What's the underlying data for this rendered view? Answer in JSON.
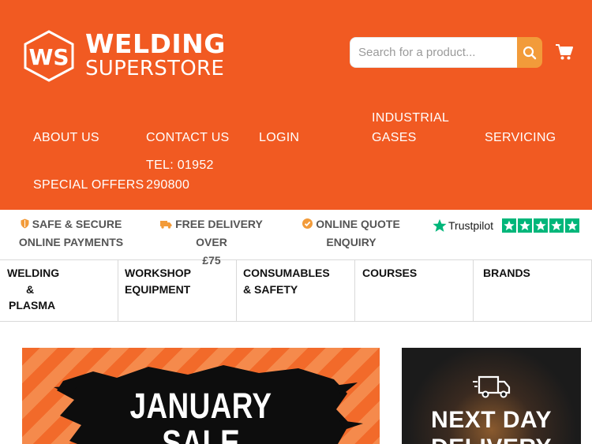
{
  "logo": {
    "line1": "WELDING",
    "line2": "SUPERSTORE",
    "mark_text": "WS"
  },
  "search": {
    "placeholder": "Search for a product...",
    "icon": "search-icon"
  },
  "cart": {
    "icon": "shopping-cart-icon"
  },
  "nav": {
    "about": "ABOUT US",
    "contact": "CONTACT US",
    "login": "LOGIN",
    "industrial_gases_1": "INDUSTRIAL",
    "industrial_gases_2": "GASES",
    "servicing": "SERVICING",
    "special_offers": "SPECIAL OFFERS",
    "tel_1": "TEL: 01952",
    "tel_2": "290800"
  },
  "usps": {
    "secure_1": "SAFE & SECURE",
    "secure_2": "ONLINE PAYMENTS",
    "delivery_1": "FREE DELIVERY OVER",
    "delivery_2": "£75",
    "quote_1": "ONLINE QUOTE",
    "quote_2": "ENQUIRY"
  },
  "trustpilot": {
    "name": "Trustpilot",
    "stars": 5
  },
  "categories": {
    "welding_1": "WELDING",
    "welding_2": "&",
    "welding_3": "PLASMA",
    "workshop_1": "WORKSHOP",
    "workshop_2": "EQUIPMENT",
    "consumables_1": "CONSUMABLES",
    "consumables_2": "& SAFETY",
    "courses": "COURSES",
    "brands": "BRANDS"
  },
  "banners": {
    "left_1": "JANUARY",
    "left_2": "SALE",
    "right_1": "NEXT DAY",
    "right_2": "DELIVERY"
  },
  "colors": {
    "brand_orange": "#f15a22",
    "search_button": "#f29b3a",
    "trustpilot_green": "#00b67a"
  }
}
